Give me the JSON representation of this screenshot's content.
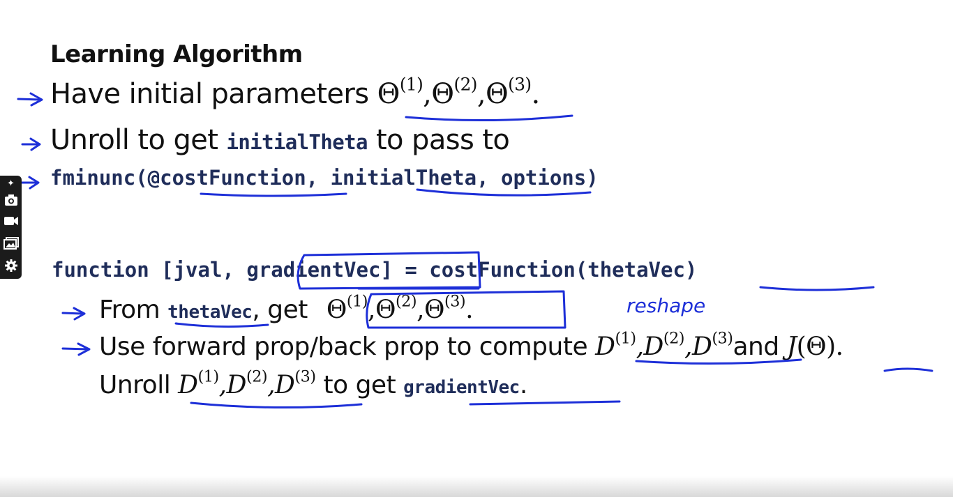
{
  "slide": {
    "title": "Learning Algorithm",
    "line1": {
      "text": "Have initial parameters",
      "theta": "Θ",
      "sup1": "(1)",
      "sup2": "(2)",
      "sup3": "(3)",
      "sep": ",",
      "end": "."
    },
    "line2": {
      "prefix": "Unroll to get",
      "code": "initialTheta",
      "suffix": "to pass to"
    },
    "line3": {
      "code": "fminunc(@costFunction, initialTheta, options)"
    },
    "line4": {
      "code_a": "function [jval,",
      "code_b": "gradientVec",
      "code_c": "] = costFunction(thetaVec)"
    },
    "line5": {
      "prefix": "From",
      "code": "thetaVec",
      "mid": ",  get"
    },
    "line6": {
      "prefix": "Use forward prop/back prop to compute",
      "d": "D",
      "and": "and",
      "j": "J",
      "jparen": "(Θ)",
      "end": "."
    },
    "line7": {
      "prefix": "Unroll",
      "suffix": "to get",
      "code": "gradientVec",
      "end": "."
    }
  },
  "annotations": {
    "handwriting": "reshape",
    "ink_color": "#1d2fd8"
  },
  "toolbar": {
    "items": [
      {
        "name": "pin",
        "icon": "pin-icon"
      },
      {
        "name": "screenshot",
        "icon": "camera-icon"
      },
      {
        "name": "record",
        "icon": "video-camera-icon"
      },
      {
        "name": "gallery",
        "icon": "images-icon"
      },
      {
        "name": "settings",
        "icon": "gear-icon"
      }
    ]
  }
}
